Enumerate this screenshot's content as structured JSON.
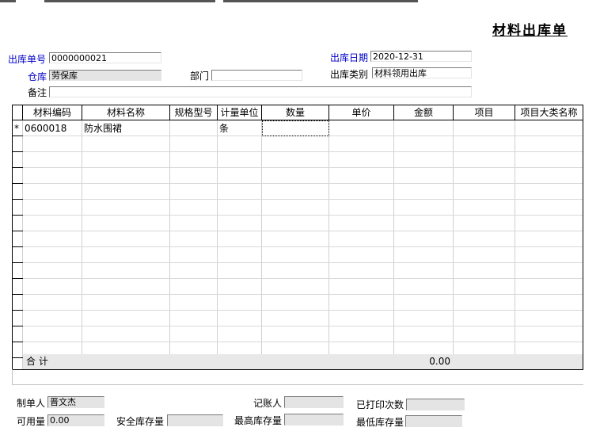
{
  "title": "材料出库单",
  "header": {
    "no_label": "出库单号",
    "no_value": "0000000021",
    "date_label": "出库日期",
    "date_value": "2020-12-31",
    "warehouse_label": "仓库",
    "warehouse_value": "劳保库",
    "dept_label": "部门",
    "dept_value": "",
    "type_label": "出库类别",
    "type_value": "材料领用出库",
    "remark_label": "备注",
    "remark_value": ""
  },
  "grid": {
    "columns": [
      "材料编码",
      "材料名称",
      "规格型号",
      "计量单位",
      "数量",
      "单价",
      "金额",
      "项目",
      "项目大类名称"
    ],
    "rows": [
      {
        "marker": "*",
        "code": "0600018",
        "name": "防水围裙",
        "spec": "",
        "unit": "条",
        "qty": "",
        "price": "",
        "amount": "",
        "project": "",
        "category": ""
      }
    ],
    "total_label": "合    计",
    "total_amount": "0.00"
  },
  "footer": {
    "maker_label": "制单人",
    "maker_value": "晋文杰",
    "bookkeeper_label": "记账人",
    "bookkeeper_value": "",
    "printed_label": "已打印次数",
    "printed_value": "",
    "available_label": "可用量",
    "available_value": "0.00",
    "safety_label": "安全库存量",
    "safety_value": "",
    "max_label": "最高库存量",
    "max_value": "",
    "min_label": "最低库存量",
    "min_value": ""
  }
}
